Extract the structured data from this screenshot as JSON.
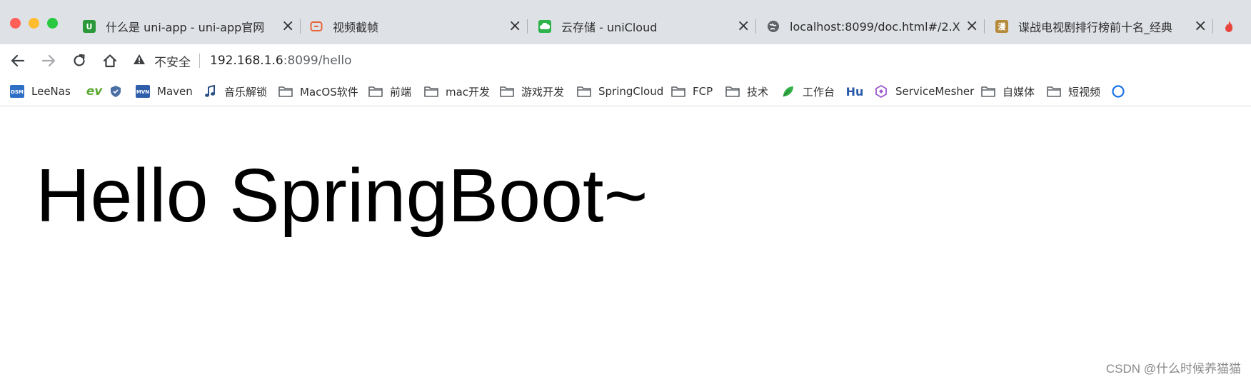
{
  "colors": {
    "tab_strip": "#dee1e6",
    "traffic_red": "#fe5f57",
    "traffic_yellow": "#febc2e",
    "traffic_green": "#28c840"
  },
  "tabs": [
    {
      "title": "什么是 uni-app - uni-app官网",
      "icon": "uni-app-icon"
    },
    {
      "title": "视频截帧",
      "icon": "video-frame-icon"
    },
    {
      "title": "云存储 - uniCloud",
      "icon": "unicloud-icon"
    },
    {
      "title": "localhost:8099/doc.html#/2.X",
      "icon": "globe-icon"
    },
    {
      "title": "谍战电视剧排行榜前十名_经典",
      "icon": "image-site-icon"
    }
  ],
  "toolbar": {
    "security_label": "不安全",
    "url_host": "192.168.1.6",
    "url_path": ":8099/hello"
  },
  "bookmarks": [
    {
      "label": "LeeNas",
      "icon": "dsm-icon"
    },
    {
      "label": "",
      "icon": "ev-icon"
    },
    {
      "label": "",
      "icon": "shield-icon"
    },
    {
      "label": "Maven",
      "icon": "mvn-icon"
    },
    {
      "label": "音乐解锁",
      "icon": "music-note-icon"
    },
    {
      "label": "MacOS软件",
      "icon": "folder-icon"
    },
    {
      "label": "前端",
      "icon": "folder-icon"
    },
    {
      "label": "mac开发",
      "icon": "folder-icon"
    },
    {
      "label": "游戏开发",
      "icon": "folder-icon"
    },
    {
      "label": "SpringCloud",
      "icon": "folder-icon"
    },
    {
      "label": "FCP",
      "icon": "folder-icon"
    },
    {
      "label": "技术",
      "icon": "folder-icon"
    },
    {
      "label": "工作台",
      "icon": "leaf-icon"
    },
    {
      "label": "",
      "icon": "hu-icon"
    },
    {
      "label": "ServiceMesher",
      "icon": "hexagon-icon"
    },
    {
      "label": "自媒体",
      "icon": "folder-icon"
    },
    {
      "label": "短视频",
      "icon": "folder-icon"
    }
  ],
  "page": {
    "heading": "Hello SpringBoot~"
  },
  "watermark": "CSDN @什么时候养猫猫"
}
